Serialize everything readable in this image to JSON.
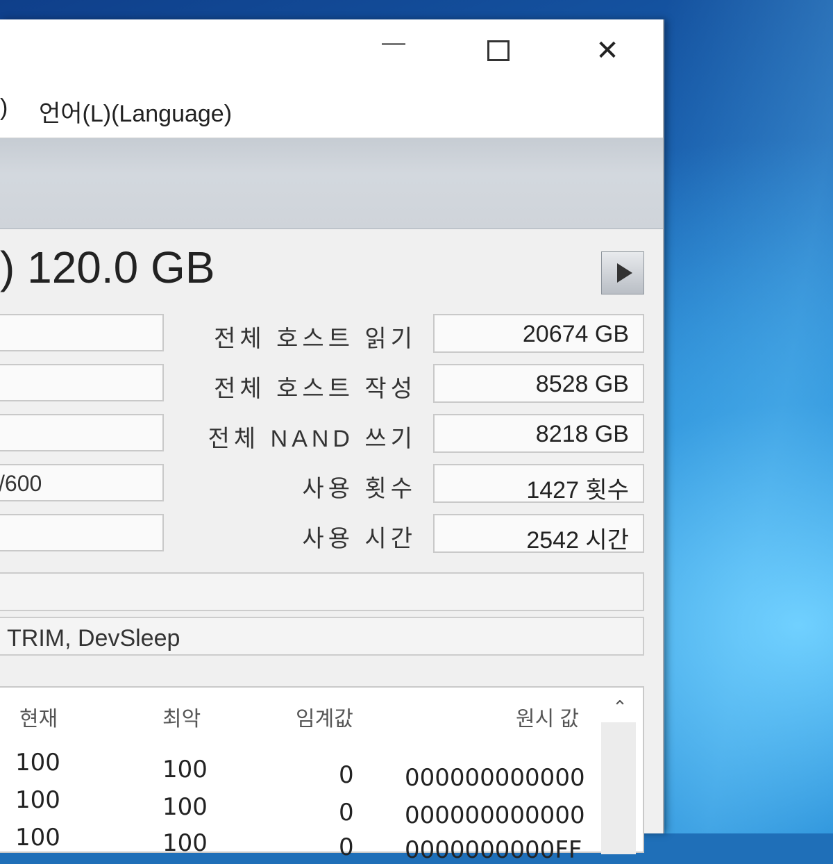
{
  "window": {
    "controls": {
      "minimize": "minimize",
      "maximize": "maximize",
      "close": "✕"
    }
  },
  "menu": {
    "items": [
      ")",
      "언어(L)(Language)"
    ]
  },
  "disk": {
    "title": ") 120.0 GB"
  },
  "left_fields": [
    "",
    "",
    "",
    "/600",
    ""
  ],
  "stats": [
    {
      "label": "전체 호스트 읽기",
      "value": "20674 GB"
    },
    {
      "label": "전체 호스트 작성",
      "value": "8528 GB"
    },
    {
      "label": "전체 NAND 쓰기",
      "value": "8218 GB"
    },
    {
      "label": "사용 횟수",
      "value": "1427 횟수"
    },
    {
      "label": "사용 시간",
      "value": "2542 시간"
    }
  ],
  "features_row_1": "",
  "features_row_2": "TRIM, DevSleep",
  "smart_table": {
    "headers": {
      "current": "현재",
      "worst": "최악",
      "threshold": "임계값",
      "raw": "원시 값"
    },
    "rows": [
      {
        "current": "100",
        "worst": "100",
        "threshold": "0",
        "raw": "000000000000"
      },
      {
        "current": "100",
        "worst": "100",
        "threshold": "0",
        "raw": "000000000000"
      },
      {
        "current": "100",
        "worst": "100",
        "threshold": "0",
        "raw": "0000000000FF"
      }
    ]
  },
  "icons": {
    "play": "play-icon",
    "scroll_up": "chevron-up-icon"
  }
}
